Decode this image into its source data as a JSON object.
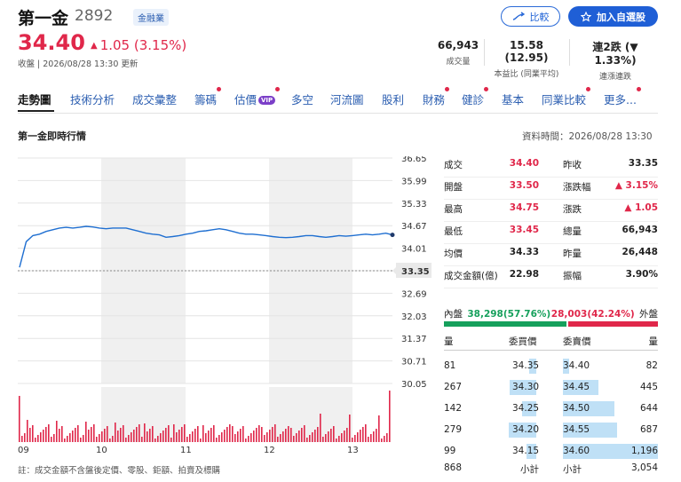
{
  "header": {
    "name": "第一金",
    "code": "2892",
    "industry_badge": "金融業",
    "price": "34.40",
    "change": "1.05 (3.15%)",
    "change_arrow": "▲",
    "close_time": "收盤 | 2026/08/28 13:30 更新",
    "compare_label": "比較",
    "watch_label": "加入自選股",
    "stats": [
      {
        "value": "66,943",
        "label": "成交量"
      },
      {
        "value": "15.58 (12.95)",
        "label": "本益比 (同業平均)"
      },
      {
        "value": "連2跌 (▼ 1.33%)",
        "label": "連漲連跌"
      }
    ]
  },
  "nav": {
    "items": [
      {
        "label": "走勢圖",
        "active": true,
        "dot": false,
        "vip": false
      },
      {
        "label": "技術分析",
        "active": false,
        "dot": false,
        "vip": false
      },
      {
        "label": "成交彙整",
        "active": false,
        "dot": false,
        "vip": false
      },
      {
        "label": "籌碼",
        "active": false,
        "dot": true,
        "vip": false
      },
      {
        "label": "估價",
        "active": false,
        "dot": true,
        "vip": true
      },
      {
        "label": "多空",
        "active": false,
        "dot": false,
        "vip": false
      },
      {
        "label": "河流圖",
        "active": false,
        "dot": false,
        "vip": false
      },
      {
        "label": "股利",
        "active": false,
        "dot": false,
        "vip": false
      },
      {
        "label": "財務",
        "active": false,
        "dot": true,
        "vip": false
      },
      {
        "label": "健診",
        "active": false,
        "dot": true,
        "vip": false
      },
      {
        "label": "基本",
        "active": false,
        "dot": false,
        "vip": false
      },
      {
        "label": "同業比較",
        "active": false,
        "dot": true,
        "vip": false
      },
      {
        "label": "更多...",
        "active": false,
        "dot": true,
        "vip": false
      }
    ],
    "vip_label": "VIP"
  },
  "section": {
    "title": "第一金即時行情",
    "data_time": "資料時間：2026/08/28 13:30"
  },
  "chart_data": {
    "type": "line",
    "y_ticks": [
      "36.65",
      "35.99",
      "35.33",
      "34.67",
      "34.01",
      "33.35",
      "32.69",
      "32.03",
      "31.37",
      "30.71",
      "30.05"
    ],
    "x_ticks": [
      "09",
      "10",
      "11",
      "12",
      "13"
    ],
    "ylim": [
      30.05,
      36.65
    ],
    "reference": 33.35,
    "reference_label": "33.35",
    "series": [
      {
        "values": [
          33.45,
          34.2,
          34.38,
          34.42,
          34.5,
          34.55,
          34.6,
          34.62,
          34.6,
          34.62,
          34.65,
          34.63,
          34.6,
          34.58,
          34.6,
          34.6,
          34.6,
          34.55,
          34.5,
          34.45,
          34.42,
          34.4,
          34.33,
          34.35,
          34.38,
          34.42,
          34.45,
          34.5,
          34.52,
          34.55,
          34.58,
          34.55,
          34.5,
          34.45,
          34.42,
          34.42,
          34.4,
          34.38,
          34.35,
          34.33,
          34.32,
          34.33,
          34.35,
          34.38,
          34.38,
          34.35,
          34.33,
          34.35,
          34.38,
          34.36,
          34.38,
          34.4,
          34.42,
          34.4,
          34.42,
          34.45,
          34.4
        ]
      }
    ]
  },
  "footnote": "註：成交金額不含盤後定價、零股、鉅額、拍賣及標購",
  "quote": {
    "left": [
      {
        "label": "成交",
        "value": "34.40",
        "color": "red"
      },
      {
        "label": "開盤",
        "value": "33.50",
        "color": "red"
      },
      {
        "label": "最高",
        "value": "34.75",
        "color": "red"
      },
      {
        "label": "最低",
        "value": "33.45",
        "color": "red"
      },
      {
        "label": "均價",
        "value": "34.33",
        "color": "dark"
      },
      {
        "label": "成交金額(億)",
        "value": "22.98",
        "color": "dark"
      }
    ],
    "right": [
      {
        "label": "昨收",
        "value": "33.35",
        "color": "dark"
      },
      {
        "label": "漲跌幅",
        "value": "▲ 3.15%",
        "color": "red"
      },
      {
        "label": "漲跌",
        "value": "▲ 1.05",
        "color": "red"
      },
      {
        "label": "總量",
        "value": "66,943",
        "color": "dark"
      },
      {
        "label": "昨量",
        "value": "26,448",
        "color": "dark"
      },
      {
        "label": "振幅",
        "value": "3.90%",
        "color": "dark"
      }
    ]
  },
  "inout": {
    "in_label": "內盤",
    "in_value": "38,298(57.76%)",
    "in_fraction": 0.5776,
    "out_value": "28,003(42.24%)",
    "out_label": "外盤"
  },
  "orderbook": {
    "headers": {
      "bid_qty": "量",
      "bid_price": "委買價",
      "ask_price": "委賣價",
      "ask_qty": "量"
    },
    "rows": [
      {
        "bid_qty": "81",
        "bid_price": "34.35",
        "ask_price": "34.40",
        "ask_qty": "82",
        "bid_level": 0.06,
        "ask_level": 0.07
      },
      {
        "bid_qty": "267",
        "bid_price": "34.30",
        "ask_price": "34.45",
        "ask_qty": "445",
        "bid_level": 0.22,
        "ask_level": 0.37
      },
      {
        "bid_qty": "142",
        "bid_price": "34.25",
        "ask_price": "34.50",
        "ask_qty": "644",
        "bid_level": 0.12,
        "ask_level": 0.54
      },
      {
        "bid_qty": "279",
        "bid_price": "34.20",
        "ask_price": "34.55",
        "ask_qty": "687",
        "bid_level": 0.23,
        "ask_level": 0.57
      },
      {
        "bid_qty": "99",
        "bid_price": "34.15",
        "ask_price": "34.60",
        "ask_qty": "1,196",
        "bid_level": 0.08,
        "ask_level": 1.0
      }
    ],
    "subtotal_label": "小計",
    "bid_total": "868",
    "ask_total": "3,054"
  }
}
